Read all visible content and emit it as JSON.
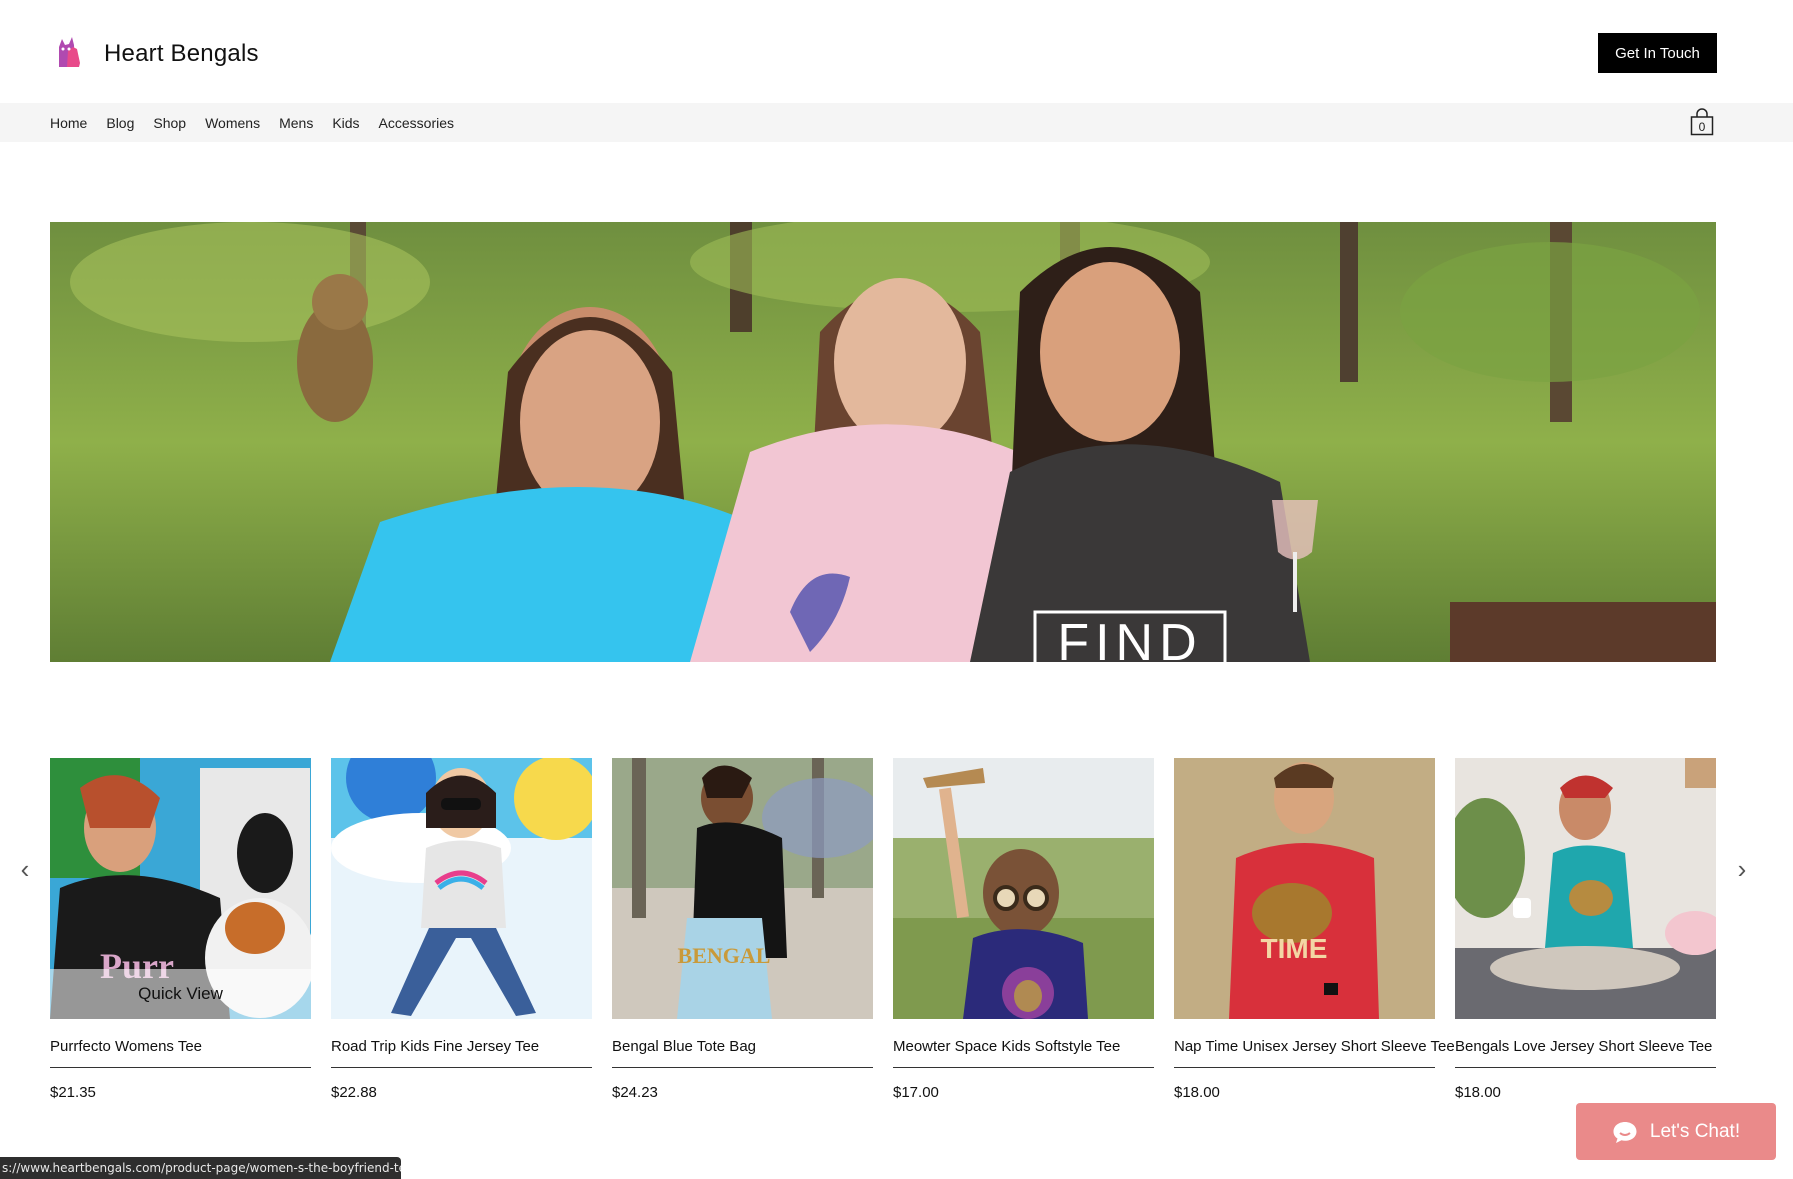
{
  "header": {
    "brand": "Heart Bengals",
    "cta_label": "Get In Touch",
    "logo_icon": "bengal-cat-logo-icon"
  },
  "nav": {
    "items": [
      {
        "label": "Home"
      },
      {
        "label": "Blog"
      },
      {
        "label": "Shop"
      },
      {
        "label": "Womens"
      },
      {
        "label": "Mens"
      },
      {
        "label": "Kids"
      },
      {
        "label": "Accessories"
      }
    ],
    "cart_count": "0"
  },
  "hero": {
    "hero_shirt_text": "FIND"
  },
  "carousel": {
    "prev_icon": "‹",
    "next_icon": "›",
    "quick_view_label": "Quick View",
    "products": [
      {
        "name": "Purrfecto Womens Tee",
        "price": "$21.35",
        "colors": {
          "bg": "#3aa7d6",
          "shirt": "#1a1a1a"
        }
      },
      {
        "name": "Road Trip Kids Fine Jersey Tee",
        "price": "$22.88",
        "colors": {
          "bg": "#e9f4fb",
          "shirt": "#e6e6e6"
        }
      },
      {
        "name": "Bengal Blue Tote Bag",
        "price": "$24.23",
        "colors": {
          "bg": "#9aa88a",
          "shirt": "#a9d3e6"
        }
      },
      {
        "name": "Meowter Space Kids Softstyle Tee",
        "price": "$17.00",
        "colors": {
          "bg": "#b7c99a",
          "shirt": "#2b2a7a"
        }
      },
      {
        "name": "Nap Time Unisex Jersey Short Sleeve Tee",
        "price": "$18.00",
        "colors": {
          "bg": "#c2ad84",
          "shirt": "#d8303b"
        }
      },
      {
        "name": "Bengals Love Jersey Short Sleeve Tee",
        "price": "$18.00",
        "colors": {
          "bg": "#e8e4df",
          "shirt": "#1fa7ad"
        }
      }
    ]
  },
  "chat": {
    "label": "Let's Chat!"
  },
  "status_bar": {
    "url": "s://www.heartbengals.com/product-page/women-s-the-boyfriend-tee"
  }
}
